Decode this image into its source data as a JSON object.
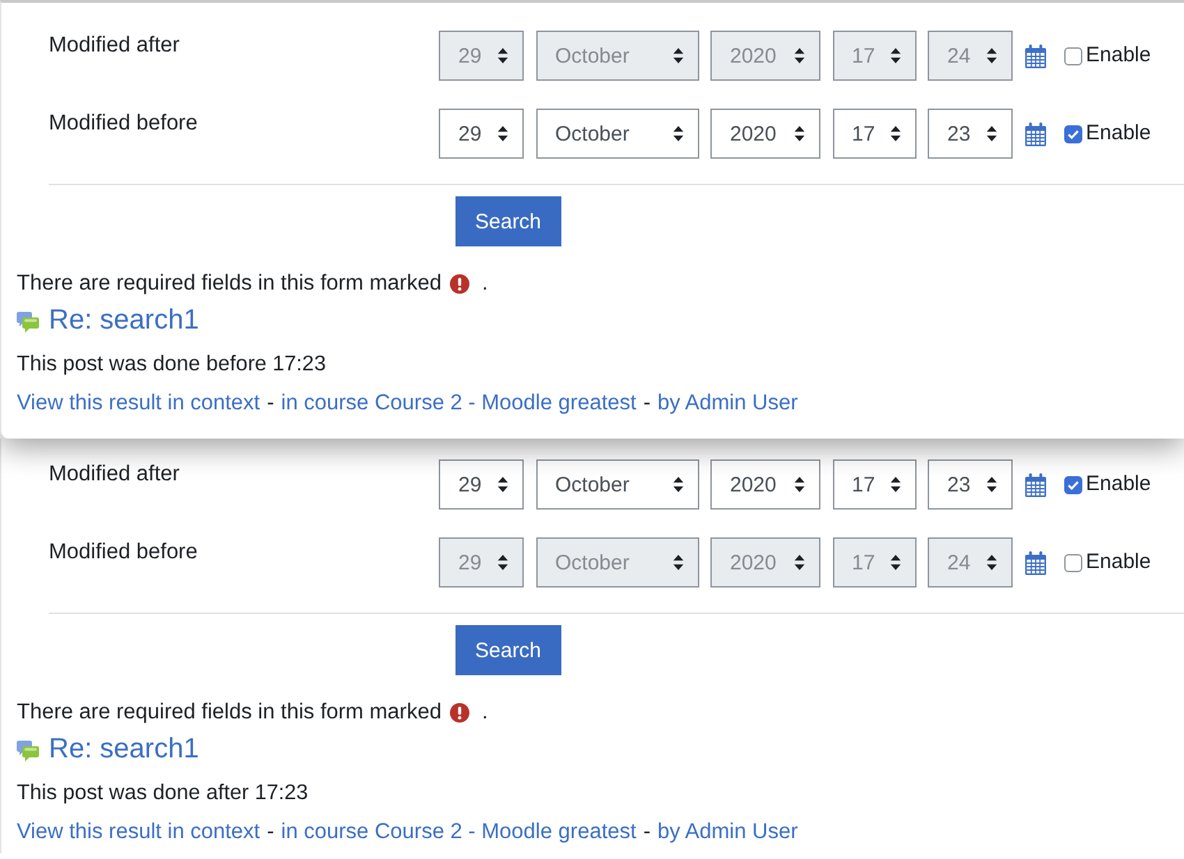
{
  "panels": [
    {
      "fields": [
        {
          "label": "Modified after",
          "enabled": false,
          "day": "29",
          "month": "October",
          "year": "2020",
          "hour": "17",
          "minute": "24",
          "checkbox_label": "Enable"
        },
        {
          "label": "Modified before",
          "enabled": true,
          "day": "29",
          "month": "October",
          "year": "2020",
          "hour": "17",
          "minute": "23",
          "checkbox_label": "Enable"
        }
      ],
      "search_button": "Search",
      "required_note": {
        "text": "There are required fields in this form marked",
        "end": "."
      },
      "result": {
        "title": "Re: search1",
        "note": "This post was done before 17:23",
        "links": [
          {
            "kind": "link",
            "text": "View this result in context"
          },
          {
            "kind": "separator",
            "text": "-"
          },
          {
            "kind": "link",
            "text": "in course Course 2 - Moodle greatest"
          },
          {
            "kind": "separator",
            "text": "-"
          },
          {
            "kind": "link",
            "text": "by Admin User"
          }
        ]
      }
    },
    {
      "fields": [
        {
          "label": "Modified after",
          "enabled": true,
          "day": "29",
          "month": "October",
          "year": "2020",
          "hour": "17",
          "minute": "23",
          "checkbox_label": "Enable"
        },
        {
          "label": "Modified before",
          "enabled": false,
          "day": "29",
          "month": "October",
          "year": "2020",
          "hour": "17",
          "minute": "24",
          "checkbox_label": "Enable"
        }
      ],
      "search_button": "Search",
      "required_note": {
        "text": "There are required fields in this form marked",
        "end": "."
      },
      "result": {
        "title": "Re: search1",
        "note": "This post was done after 17:23",
        "links": [
          {
            "kind": "link",
            "text": "View this result in context"
          },
          {
            "kind": "separator",
            "text": "-"
          },
          {
            "kind": "link",
            "text": "in course Course 2 - Moodle greatest"
          },
          {
            "kind": "separator",
            "text": "-"
          },
          {
            "kind": "link",
            "text": "by Admin User"
          }
        ]
      }
    }
  ]
}
